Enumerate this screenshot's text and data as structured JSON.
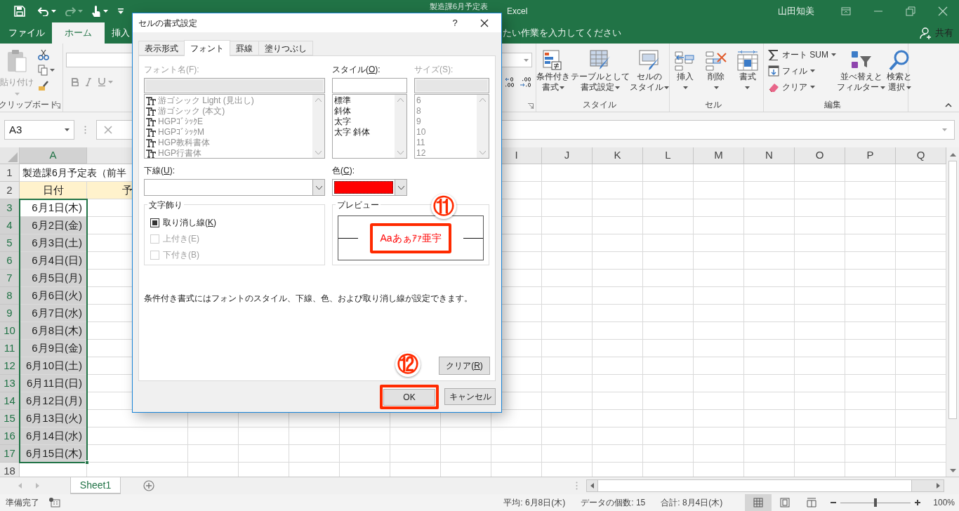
{
  "title_bar": {
    "document": "製造課6月予定表",
    "app": "Excel",
    "user": "山田知美"
  },
  "ribbon_tabs": [
    {
      "label": "ファイル",
      "selected": false
    },
    {
      "label": "ホーム",
      "selected": true
    },
    {
      "label": "挿入",
      "selected": false
    }
  ],
  "tell_me": "たい作業を入力してください",
  "share": "共有",
  "clipboard": {
    "paste": "貼り付け",
    "group": "クリップボード"
  },
  "styles_group": {
    "group": "スタイル",
    "buttons": [
      {
        "kind": "conditional",
        "lines": [
          "条件付き",
          "書式"
        ]
      },
      {
        "kind": "table",
        "lines": [
          "テーブルとして",
          "書式設定"
        ]
      },
      {
        "kind": "cellstyle",
        "lines": [
          "セルの",
          "スタイル"
        ]
      }
    ]
  },
  "cells_group": {
    "group": "セル",
    "buttons": [
      {
        "kind": "insert",
        "label": "挿入"
      },
      {
        "kind": "delete",
        "label": "削除"
      },
      {
        "kind": "format",
        "label": "書式"
      }
    ]
  },
  "editing_group": {
    "group": "編集",
    "small": [
      {
        "kind": "sum",
        "label": "オート SUM"
      },
      {
        "kind": "fill",
        "label": "フィル"
      },
      {
        "kind": "clear",
        "label": "クリア"
      }
    ],
    "big": [
      {
        "kind": "sort",
        "lines": [
          "並べ替えと",
          "フィルター"
        ]
      },
      {
        "kind": "find",
        "lines": [
          "検索と",
          "選択"
        ]
      }
    ]
  },
  "name_box": "A3",
  "columns": [
    {
      "label": "A",
      "selected": true
    },
    {
      "label": "I",
      "selected": false
    },
    {
      "label": "J",
      "selected": false
    },
    {
      "label": "K",
      "selected": false
    },
    {
      "label": "L",
      "selected": false
    },
    {
      "label": "M",
      "selected": false
    },
    {
      "label": "N",
      "selected": false
    },
    {
      "label": "O",
      "selected": false
    },
    {
      "label": "P",
      "selected": false
    },
    {
      "label": "Q",
      "selected": false
    }
  ],
  "rows": [
    {
      "header": "1",
      "kind": "title",
      "cell": "製造課6月予定表（前半",
      "selected": false,
      "active": false
    },
    {
      "header": "2",
      "kind": "heading",
      "cell": "日付",
      "next": "予",
      "selected": false,
      "active": false
    },
    {
      "header": "3",
      "kind": "date",
      "cell": "6月1日(木)",
      "selected": true,
      "active": true
    },
    {
      "header": "4",
      "kind": "date",
      "cell": "6月2日(金)",
      "selected": true,
      "active": false
    },
    {
      "header": "5",
      "kind": "date",
      "cell": "6月3日(土)",
      "selected": true,
      "active": false
    },
    {
      "header": "6",
      "kind": "date",
      "cell": "6月4日(日)",
      "selected": true,
      "active": false
    },
    {
      "header": "7",
      "kind": "date",
      "cell": "6月5日(月)",
      "selected": true,
      "active": false
    },
    {
      "header": "8",
      "kind": "date",
      "cell": "6月6日(火)",
      "selected": true,
      "active": false
    },
    {
      "header": "9",
      "kind": "date",
      "cell": "6月7日(水)",
      "selected": true,
      "active": false
    },
    {
      "header": "10",
      "kind": "date",
      "cell": "6月8日(木)",
      "selected": true,
      "active": false
    },
    {
      "header": "11",
      "kind": "date",
      "cell": "6月9日(金)",
      "selected": true,
      "active": false
    },
    {
      "header": "12",
      "kind": "date",
      "cell": "6月10日(土)",
      "selected": true,
      "active": false
    },
    {
      "header": "13",
      "kind": "date",
      "cell": "6月11日(日)",
      "selected": true,
      "active": false
    },
    {
      "header": "14",
      "kind": "date",
      "cell": "6月12日(月)",
      "selected": true,
      "active": false
    },
    {
      "header": "15",
      "kind": "date",
      "cell": "6月13日(火)",
      "selected": true,
      "active": false
    },
    {
      "header": "16",
      "kind": "date",
      "cell": "6月14日(水)",
      "selected": true,
      "active": false
    },
    {
      "header": "17",
      "kind": "date",
      "cell": "6月15日(木)",
      "selected": true,
      "active": false
    },
    {
      "header": "18",
      "kind": "empty",
      "selected": false,
      "active": false
    }
  ],
  "sheet_tabs": [
    {
      "label": "Sheet1",
      "selected": true
    }
  ],
  "status": {
    "ready": "準備完了",
    "stats": [
      "平均: 6月8日(木)",
      "データの個数: 15",
      "合計: 8月4日(木)"
    ],
    "views": [
      {
        "kind": "normal",
        "selected": true
      },
      {
        "kind": "layout",
        "selected": false
      },
      {
        "kind": "break",
        "selected": false
      }
    ],
    "zoom": {
      "level": 0.5,
      "reading": "100%"
    }
  },
  "dialog": {
    "title": "セルの書式設定",
    "help": "?",
    "tabs": [
      {
        "label": "表示形式",
        "selected": false
      },
      {
        "label": "フォント",
        "selected": true
      },
      {
        "label": "罫線",
        "selected": false
      },
      {
        "label": "塗りつぶし",
        "selected": false
      }
    ],
    "font_name": {
      "label": [
        "フォント名(F):"
      ],
      "disabled": true,
      "items": [
        "游ゴシック Light (見出し)",
        "游ゴシック (本文)",
        "HGPｺﾞｼｯｸE",
        "HGPｺﾞｼｯｸM",
        "HGP教科書体",
        "HGP行書体"
      ]
    },
    "style": {
      "label": [
        "スタイル(",
        "O",
        "):"
      ],
      "disabled": false,
      "items": [
        "標準",
        "斜体",
        "太字",
        "太字 斜体"
      ]
    },
    "size": {
      "label": [
        "サイズ(S):"
      ],
      "disabled": true,
      "items": [
        "6",
        "8",
        "9",
        "10",
        "11",
        "12"
      ]
    },
    "underline": {
      "label": [
        "下線(",
        "U",
        "):"
      ]
    },
    "color": {
      "label": [
        "色(",
        "C",
        "):"
      ],
      "color": "#ff0000"
    },
    "effects": {
      "legend": "文字飾り",
      "options": [
        {
          "label": [
            "取り消し線(",
            "K",
            ")"
          ],
          "checked": true,
          "disabled": false
        },
        {
          "label": [
            "上付き(E)"
          ],
          "checked": false,
          "disabled": true
        },
        {
          "label": [
            "下付き(B)"
          ],
          "checked": false,
          "disabled": true
        }
      ]
    },
    "preview": {
      "legend": "プレビュー",
      "sample": "Aaあぁｱｧ亜宇",
      "callout": "⑪"
    },
    "note": "条件付き書式にはフォントのスタイル、下線、色、および取り消し線が設定できます。",
    "clear": [
      "クリア(",
      "R",
      ")"
    ],
    "ok": {
      "label": "OK",
      "callout": "⑫"
    },
    "cancel": "キャンセル"
  }
}
